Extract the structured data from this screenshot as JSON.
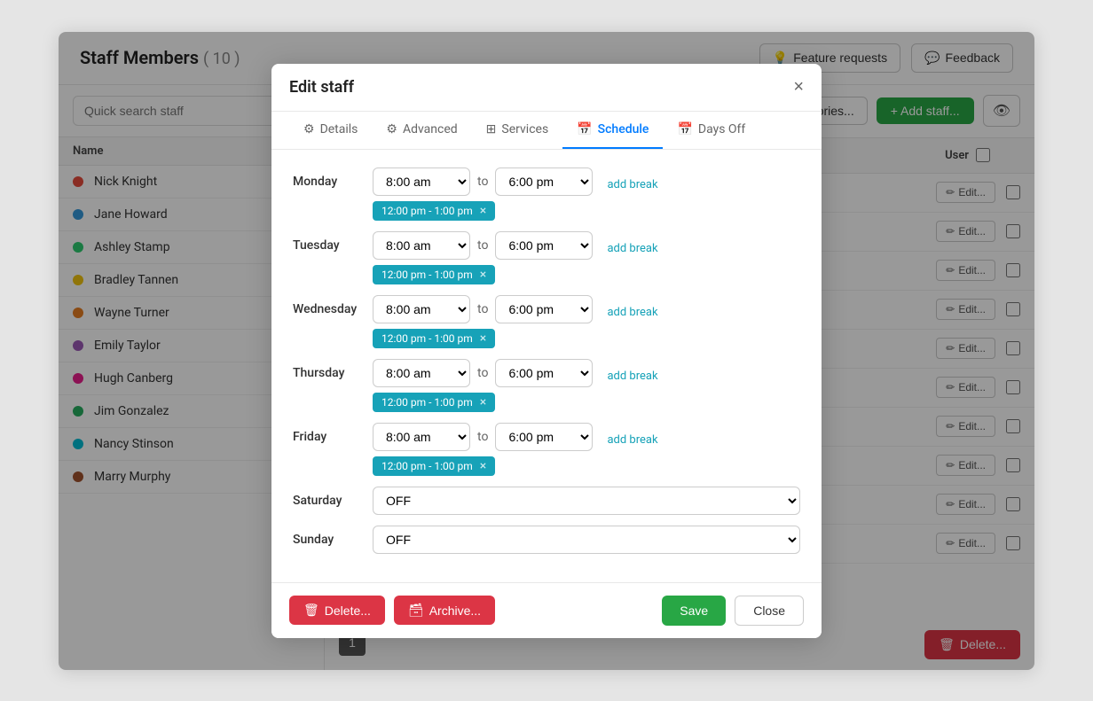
{
  "app": {
    "title": "Staff Members",
    "count": "( 10 )",
    "feature_requests": "Feature requests",
    "feedback": "Feedback",
    "add_staff": "+ Add staff...",
    "categories": "ategories..."
  },
  "search": {
    "placeholder": "Quick search staff"
  },
  "table": {
    "name_header": "Name",
    "user_header": "User"
  },
  "staff": [
    {
      "name": "Nick Knight",
      "color": "#e74c3c"
    },
    {
      "name": "Jane Howard",
      "color": "#3498db"
    },
    {
      "name": "Ashley Stamp",
      "color": "#2ecc71"
    },
    {
      "name": "Bradley Tannen",
      "color": "#f1c40f"
    },
    {
      "name": "Wayne Turner",
      "color": "#e67e22"
    },
    {
      "name": "Emily Taylor",
      "color": "#9b59b6"
    },
    {
      "name": "Hugh Canberg",
      "color": "#e91e8c"
    },
    {
      "name": "Jim Gonzalez",
      "color": "#27ae60"
    },
    {
      "name": "Nancy Stinson",
      "color": "#00bcd4"
    },
    {
      "name": "Marry Murphy",
      "color": "#a0522d"
    }
  ],
  "pagination": {
    "current_page": "1"
  },
  "modal": {
    "title": "Edit staff",
    "tabs": [
      {
        "label": "Details",
        "icon": "⚙"
      },
      {
        "label": "Advanced",
        "icon": "⚙"
      },
      {
        "label": "Services",
        "icon": "⊞"
      },
      {
        "label": "Schedule",
        "icon": "📅",
        "active": true
      },
      {
        "label": "Days Off",
        "icon": "📅"
      }
    ],
    "schedule": {
      "days": [
        {
          "day": "Monday",
          "type": "hours",
          "start": "8:00 am",
          "end": "6:00 pm",
          "break": "12:00 pm - 1:00 pm"
        },
        {
          "day": "Tuesday",
          "type": "hours",
          "start": "8:00 am",
          "end": "6:00 pm",
          "break": "12:00 pm - 1:00 pm"
        },
        {
          "day": "Wednesday",
          "type": "hours",
          "start": "8:00 am",
          "end": "6:00 pm",
          "break": "12:00 pm - 1:00 pm"
        },
        {
          "day": "Thursday",
          "type": "hours",
          "start": "8:00 am",
          "end": "6:00 pm",
          "break": "12:00 pm - 1:00 pm"
        },
        {
          "day": "Friday",
          "type": "hours",
          "start": "8:00 am",
          "end": "6:00 pm",
          "break": "12:00 pm - 1:00 pm"
        },
        {
          "day": "Saturday",
          "type": "off"
        },
        {
          "day": "Sunday",
          "type": "off"
        }
      ],
      "add_break_label": "add break",
      "off_label": "OFF"
    },
    "footer": {
      "delete_label": "Delete...",
      "archive_label": "Archive...",
      "save_label": "Save",
      "close_label": "Close"
    }
  },
  "delete_button": "Delete..."
}
